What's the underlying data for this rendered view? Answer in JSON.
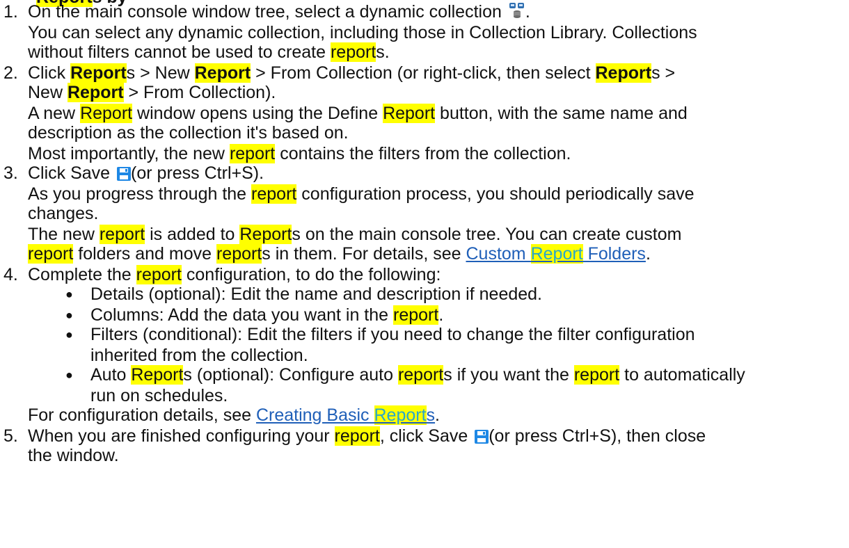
{
  "doc": {
    "cut_heading_fragment": "Report",
    "cut_heading_rest": "s by",
    "step1": {
      "num": "1.",
      "a": "On the main console window tree, select a dynamic collection",
      "a_icon": "dynamic-collection-icon",
      "a_end": ".",
      "b": "You can select any dynamic collection, including those in Collection Library. Collections",
      "c1": "without filters cannot be used to create ",
      "c_hl": "report",
      "c2": "s."
    },
    "step2": {
      "num": "2.",
      "a1": "Click ",
      "a_b1": "Report",
      "a2": "s > New ",
      "a_b2": "Report",
      "a3": " > From Collection (or right-click, then select ",
      "a_b3": "Report",
      "a4": "s >",
      "b1": "New ",
      "b_b": "Report",
      "b2": " > From Collection).",
      "c1": "A new ",
      "c_hl1": "Report",
      "c2": " window opens using the Define ",
      "c_hl2": "Report",
      "c3": " button, with the same name and",
      "d": "description as the collection it's based on.",
      "e1": "Most importantly, the new ",
      "e_hl": "report",
      "e2": " contains the filters from the collection."
    },
    "step3": {
      "num": "3.",
      "a1": "Click Save ",
      "a_icon": "save-icon",
      "a2": "(or press Ctrl+S).",
      "b1": "As you progress through the ",
      "b_hl": "report",
      "b2": " configuration process, you should periodically save",
      "c": "changes.",
      "d1": "The new ",
      "d_hl1": "report",
      "d2": " is added to ",
      "d_hl2": "Report",
      "d3": "s on the main console tree. You can create custom",
      "e_hl1": "report",
      "e1": " folders and move ",
      "e_hl2": "report",
      "e2": "s in them. For details, see ",
      "e_link1": "Custom ",
      "e_link_hl": "Report",
      "e_link2": " Folders",
      "e3": "."
    },
    "step4": {
      "num": "4.",
      "a1": "Complete the ",
      "a_hl": "report",
      "a2": " configuration, to do the following:",
      "bullets": {
        "b1_1": "Details (optional): Edit the name and description if needed.",
        "b2_1": "Columns: Add the data you want in the ",
        "b2_hl": "report",
        "b2_2": ".",
        "b3_1": "Filters (conditional): Edit the filters if you need to change the filter configuration",
        "b3_2": "inherited from the collection.",
        "b4_1": "Auto ",
        "b4_hl1": "Report",
        "b4_2": "s (optional): Configure auto ",
        "b4_hl2": "report",
        "b4_3": "s if you want the ",
        "b4_hl3": "report",
        "b4_4": " to automatically",
        "b4_5": "run on schedules."
      },
      "f1": "For configuration details, see ",
      "f_link1": "Creating Basic ",
      "f_link_hl": "Report",
      "f_link2": "s",
      "f2": "."
    },
    "step5": {
      "num": "5.",
      "a1": "When you are finished configuring your ",
      "a_hl": "report",
      "a2": ", click Save ",
      "a_icon": "save-icon",
      "a3": "(or press Ctrl+S), then close",
      "b": "the window."
    },
    "colors": {
      "highlight": "#ffff00",
      "link": "#1f5fb8",
      "link_highlighted_text": "#2aa7c9",
      "save_icon": "#1e88e5"
    }
  }
}
